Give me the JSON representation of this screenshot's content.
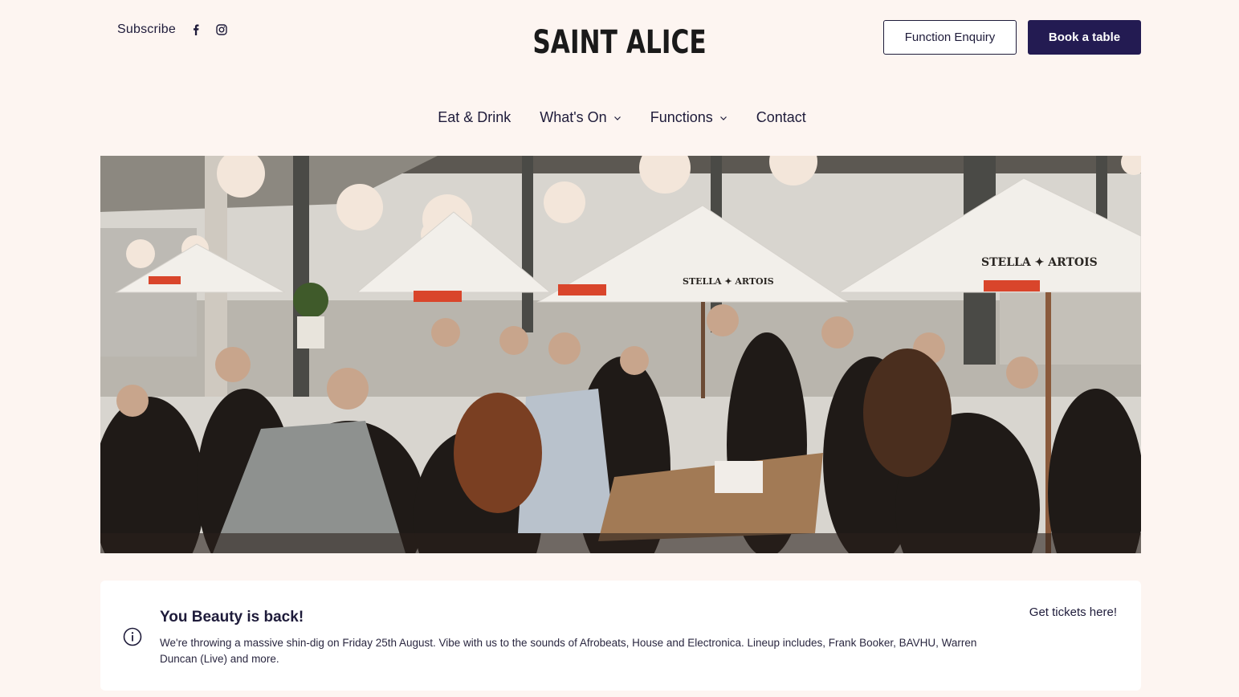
{
  "header": {
    "subscribe_label": "Subscribe",
    "social_icons": [
      "facebook-icon",
      "instagram-icon"
    ],
    "logo_text": "SAINT ALICE",
    "function_enquiry_label": "Function Enquiry",
    "book_table_label": "Book a table"
  },
  "nav": {
    "items": [
      {
        "label": "Eat & Drink",
        "has_dropdown": false
      },
      {
        "label": "What's On",
        "has_dropdown": true
      },
      {
        "label": "Functions",
        "has_dropdown": true
      },
      {
        "label": "Contact",
        "has_dropdown": false
      }
    ]
  },
  "hero": {
    "umbrella_text": "STELLA ✦ ARTOIS"
  },
  "notice": {
    "icon": "info-icon",
    "title": "You Beauty is back!",
    "body": "We're throwing a massive shin-dig on Friday 25th August. Vibe with us to the sounds of Afrobeats, House and Electronica. Lineup includes, Frank Booker, BAVHU, Warren Duncan (Live) and more.",
    "link_label": "Get tickets here!"
  },
  "colors": {
    "background": "#fdf5f1",
    "primary": "#231b52",
    "text": "#1e1b3a",
    "card": "#ffffff"
  }
}
